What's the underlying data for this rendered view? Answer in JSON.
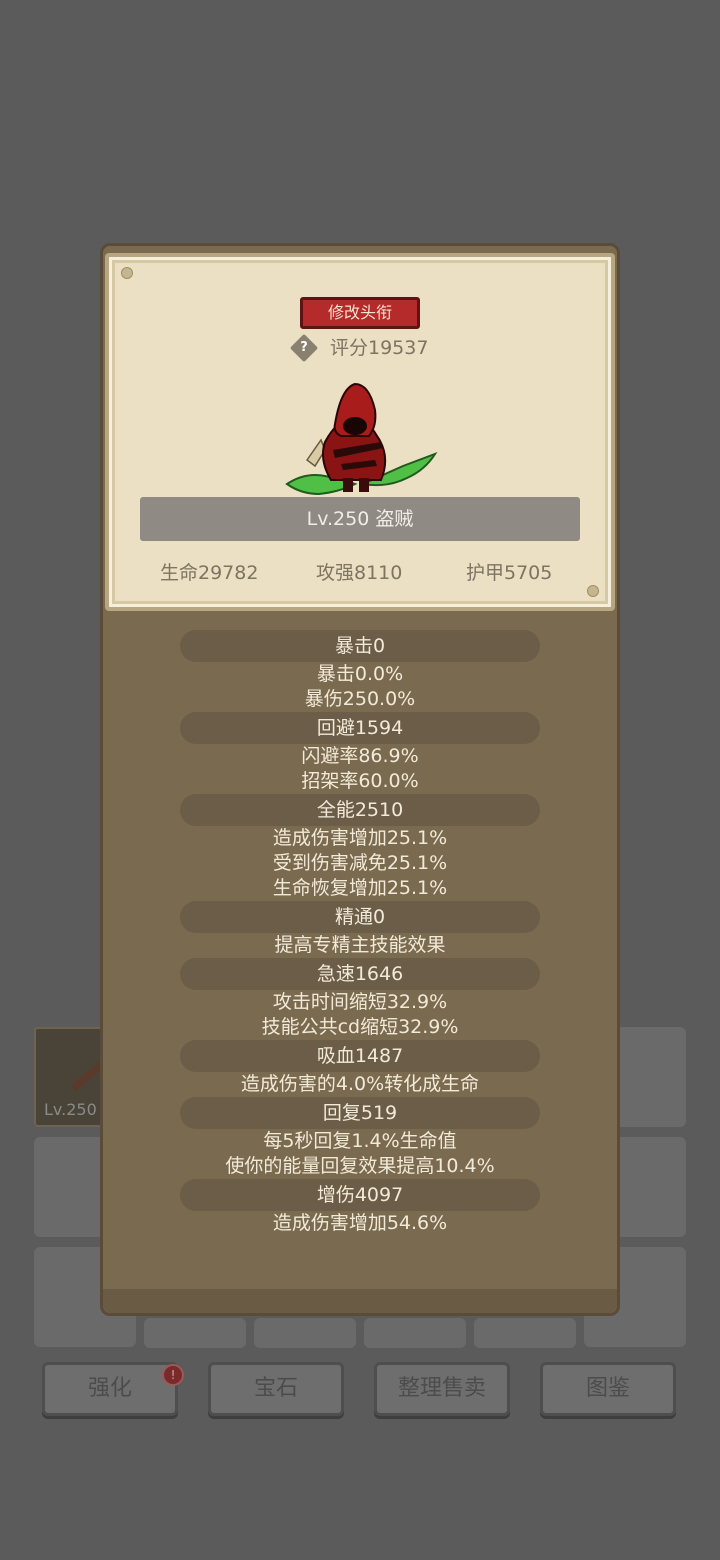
{
  "card": {
    "title_button": "修改头衔",
    "help_icon": "?",
    "score": "评分19537",
    "name": "Lv.250 盗贼",
    "basics": [
      "生命29782",
      "攻强8110",
      "护甲5705"
    ]
  },
  "stats": [
    {
      "head": "暴击0",
      "lines": [
        "暴击0.0%",
        "暴伤250.0%"
      ]
    },
    {
      "head": "回避1594",
      "lines": [
        "闪避率86.9%",
        "招架率60.0%"
      ]
    },
    {
      "head": "全能2510",
      "lines": [
        "造成伤害增加25.1%",
        "受到伤害减免25.1%",
        "生命恢复增加25.1%"
      ]
    },
    {
      "head": "精通0",
      "lines": [
        "提高专精主技能效果"
      ]
    },
    {
      "head": "急速1646",
      "lines": [
        "攻击时间缩短32.9%",
        "技能公共cd缩短32.9%"
      ]
    },
    {
      "head": "吸血1487",
      "lines": [
        "造成伤害的4.0%转化成生命"
      ]
    },
    {
      "head": "回复519",
      "lines": [
        "每5秒回复1.4%生命值",
        "使你的能量回复效果提高10.4%"
      ]
    },
    {
      "head": "增伤4097",
      "lines": [
        "造成伤害增加54.6%"
      ]
    }
  ],
  "background": {
    "item_level": "Lv.250",
    "buttons": [
      "强化",
      "宝石",
      "整理售卖",
      "图鉴"
    ],
    "badge": "!"
  }
}
